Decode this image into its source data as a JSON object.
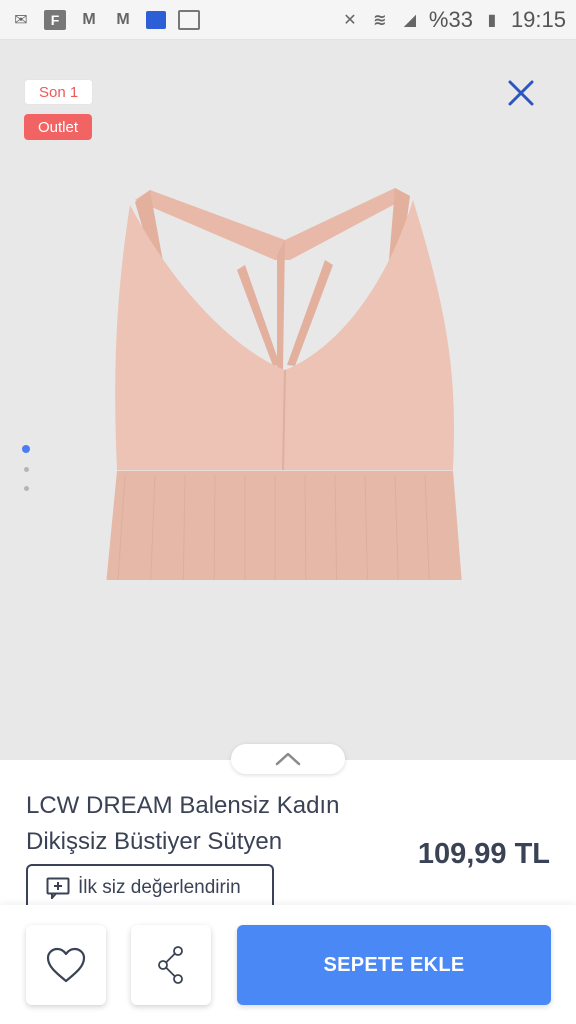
{
  "status_bar": {
    "left_icons": [
      "mail-icon",
      "flipboard-icon",
      "gmail-icon",
      "gmail-icon-2",
      "app-icon",
      "gallery-icon"
    ],
    "battery": "%33",
    "time": "19:15"
  },
  "gallery": {
    "badges": {
      "son": "Son 1",
      "outlet": "Outlet"
    },
    "image_count": 3,
    "active_index": 0,
    "product_color": "#ecc3b4"
  },
  "product": {
    "title_line1": "LCW DREAM Balensiz Kadın",
    "title_line2": "Dikişsiz Büstiyer Sütyen",
    "price": "109,99 TL",
    "review_label": "İlk siz değerlendirin"
  },
  "actions": {
    "add_to_cart": "SEPETE EKLE"
  },
  "colors": {
    "accent": "#4a88f5",
    "outlet_badge": "#f26464",
    "text_dark": "#3a4255",
    "close_icon": "#2c55c0"
  }
}
